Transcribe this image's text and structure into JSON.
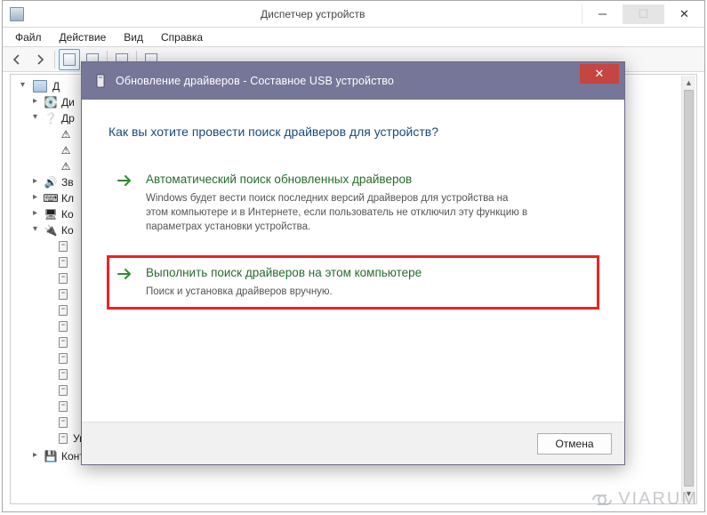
{
  "dm": {
    "title": "Диспетчер устройств",
    "menu": {
      "file": "Файл",
      "action": "Действие",
      "view": "Вид",
      "help": "Справка"
    },
    "root": "Д",
    "nodes": [
      {
        "label": "Ди",
        "expanded": false
      },
      {
        "label": "Др",
        "expanded": true
      },
      {
        "label": "Зв",
        "expanded": false
      },
      {
        "label": "Кл",
        "expanded": false
      },
      {
        "label": "Ко",
        "expanded": false
      },
      {
        "label": "Ко",
        "expanded": true
      }
    ],
    "bottom_items": [
      "Универсальный USB-концентратор",
      "Контроллеры запоминающих устройств"
    ]
  },
  "dialog": {
    "title": "Обновление драйверов - Составное USB устройство",
    "heading": "Как вы хотите провести поиск драйверов для устройств?",
    "opt1": {
      "title": "Автоматический поиск обновленных драйверов",
      "desc": "Windows будет вести поиск последних версий драйверов для устройства на этом компьютере и в Интернете, если пользователь не отключил эту функцию в параметрах установки устройства."
    },
    "opt2": {
      "title": "Выполнить поиск драйверов на этом компьютере",
      "desc": "Поиск и установка драйверов вручную."
    },
    "cancel": "Отмена"
  },
  "watermark": "VIARUM"
}
